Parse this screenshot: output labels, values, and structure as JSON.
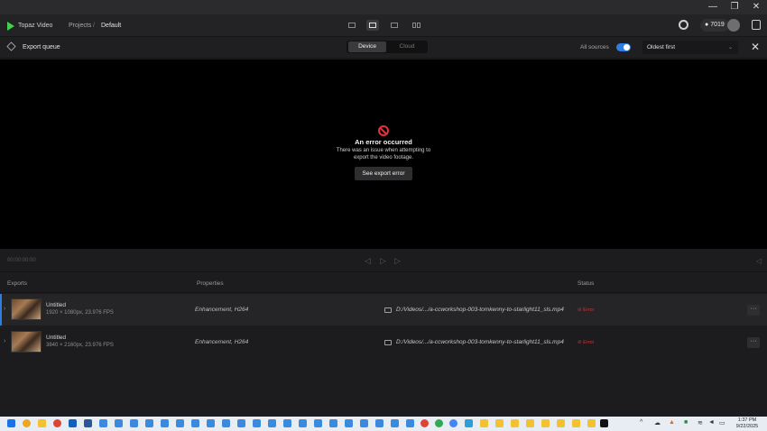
{
  "window": {
    "minimize": "—",
    "maximize": "❐",
    "close": "✕"
  },
  "header": {
    "app_name": "Topaz Video",
    "breadcrumbs": [
      "Projects",
      "Default"
    ],
    "breadcrumb_sep": "/",
    "credits": "7019",
    "credits_icon": "plus-circle-icon"
  },
  "queue": {
    "title": "Export queue",
    "tabs": [
      "Device",
      "Cloud"
    ],
    "selected_tab": "Device",
    "all_sources_label": "All sources",
    "all_sources_on": true,
    "sort_value": "Oldest first",
    "close": "✕"
  },
  "preview": {
    "error_title": "An error occurred",
    "error_desc": "There was an issue when attempting to export the video footage.",
    "error_button": "See export error"
  },
  "playback": {
    "timecode": "00:00:00:00"
  },
  "table": {
    "headers": [
      "Exports",
      "Properties",
      "Status"
    ],
    "rows": [
      {
        "title": "Untitled",
        "sub": "1920 × 1080px, 23.976 FPS",
        "props": "Enhancement, H264",
        "path": "D:/Videos/.../a-ccworkshop-003-tomkenny-to-starlight11_sls.mp4",
        "status": "⊘ Error"
      },
      {
        "title": "Untitled",
        "sub": "3840 × 2160px, 23.976 FPS",
        "props": "Enhancement, H264",
        "path": "D:/Videos/.../a-ccworkshop-003-tomkenny-to-starlight11_sls.mp4",
        "status": "⊘ Error"
      }
    ],
    "more": "···"
  },
  "taskbar": {
    "time": "1:37 PM",
    "date": "9/22/2025",
    "colors": {
      "accent": "#2f7de1",
      "error": "#c0393f",
      "brand": "#3fd24a"
    }
  }
}
